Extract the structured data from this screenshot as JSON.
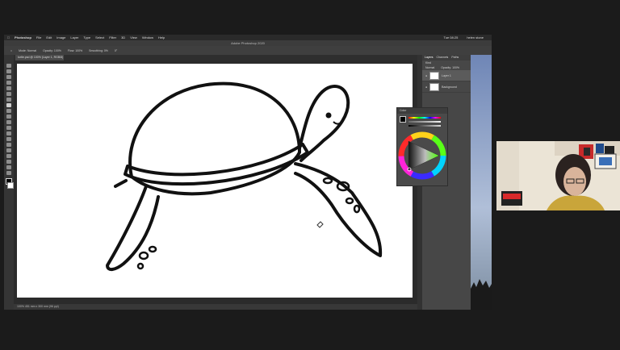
{
  "menubar": {
    "apple": "",
    "items": [
      "Photoshop",
      "File",
      "Edit",
      "Image",
      "Layer",
      "Type",
      "Select",
      "Filter",
      "3D",
      "View",
      "Window",
      "Help"
    ],
    "time": "Tue 08:25",
    "user": "helen stone"
  },
  "window": {
    "title": "Adobe Photoshop 2020"
  },
  "options_bar": {
    "items": [
      "Mode: Normal",
      "Opacity: 100%",
      "Flow: 100%",
      "Smoothing: 0%",
      "0°"
    ]
  },
  "document": {
    "tab_label": "turtle.psd @ 100% (Layer 1, RGB/8) ×",
    "status": "100%   451 mm x 300 mm (96 ppi)"
  },
  "layers_panel": {
    "tabs": [
      "Layers",
      "Channels",
      "Paths"
    ],
    "kind": "Kind",
    "mode": "Normal",
    "opacity": "Opacity: 100%",
    "layers": [
      {
        "name": "Layer 1",
        "selected": true
      },
      {
        "name": "Background",
        "selected": false
      }
    ]
  },
  "color_panel": {
    "title": "Color"
  },
  "colors": {
    "accent": "#1473e6",
    "canvas": "#ffffff",
    "ui_dark": "#3a3a3a",
    "stroke": "#111111"
  }
}
